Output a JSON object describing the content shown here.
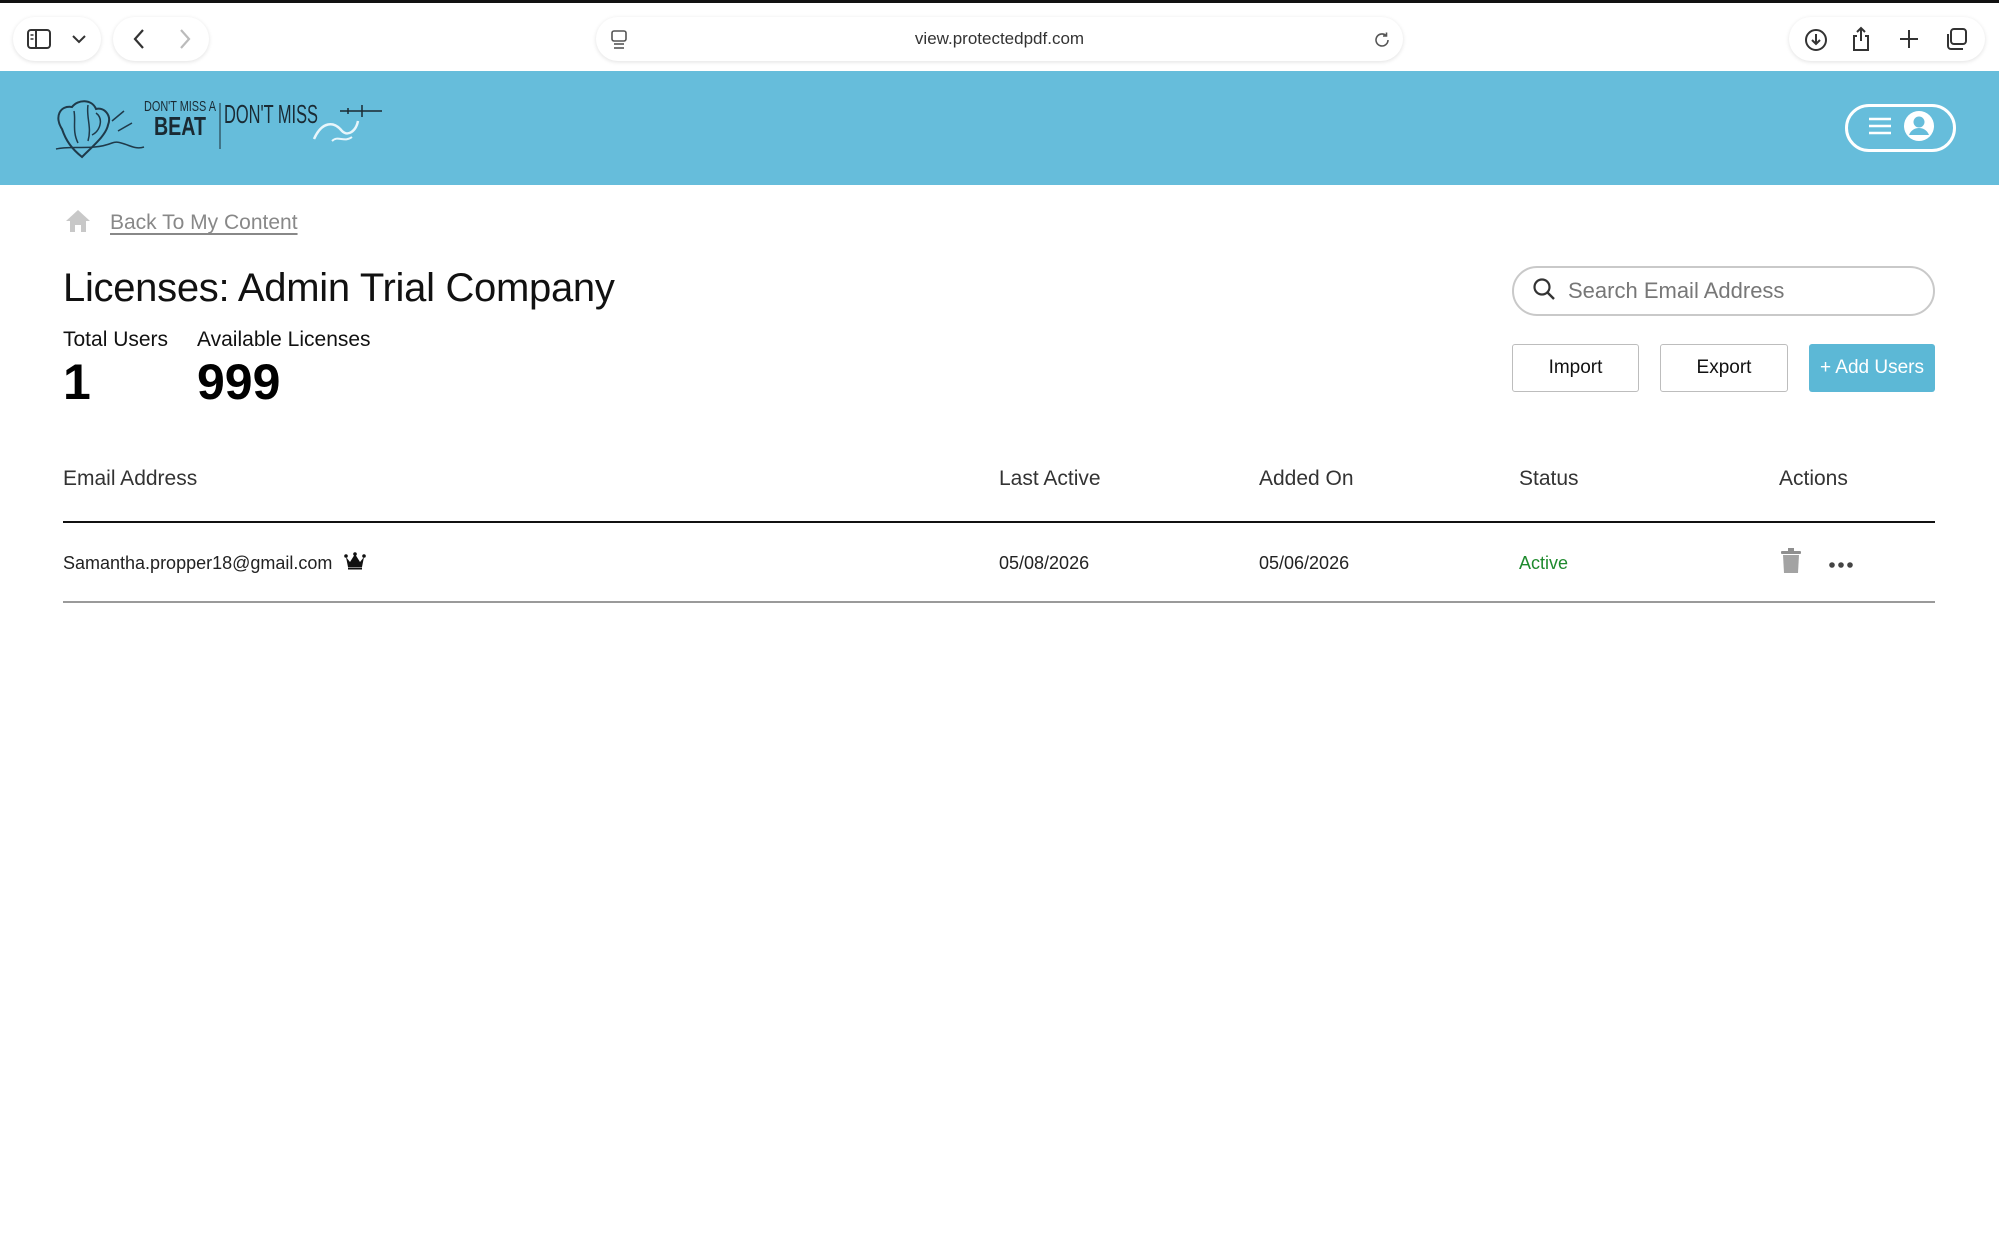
{
  "browser": {
    "url": "view.protectedpdf.com"
  },
  "header": {
    "logo_text_left_top": "DON'T MISS A",
    "logo_text_left_bottom": "BEAT",
    "logo_text_right": "DON'T MISS",
    "brand_color": "#66bddb"
  },
  "nav": {
    "back_label": "Back To My Content"
  },
  "page": {
    "title": "Licenses: Admin Trial Company"
  },
  "stats": {
    "total_users_label": "Total Users",
    "total_users_value": "1",
    "available_licenses_label": "Available Licenses",
    "available_licenses_value": "999"
  },
  "search": {
    "placeholder": "Search Email Address"
  },
  "actions": {
    "import_label": "Import",
    "export_label": "Export",
    "add_users_label": "+ Add Users",
    "accent_color": "#5cb8d6"
  },
  "table": {
    "headers": {
      "email": "Email Address",
      "last_active": "Last Active",
      "added_on": "Added On",
      "status": "Status",
      "actions": "Actions"
    },
    "rows": [
      {
        "email": "Samantha.propper18@gmail.com",
        "is_owner_icon": "crown-icon",
        "last_active": "05/08/2026",
        "added_on": "05/06/2026",
        "status": "Active",
        "status_color": "#1e8a2d"
      }
    ]
  }
}
